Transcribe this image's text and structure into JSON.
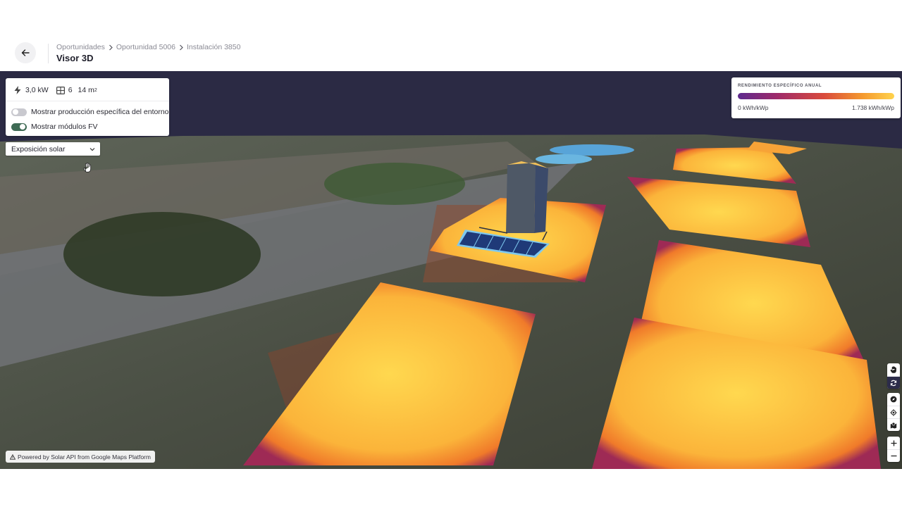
{
  "header": {
    "breadcrumb": [
      "Oportunidades",
      "Oportunidad 5006",
      "Instalación 3850"
    ],
    "title": "Visor 3D",
    "back_icon": "arrow-left-icon"
  },
  "info_panel": {
    "power": "3,0 kW",
    "modules_count": "6",
    "area_value": "14 m",
    "area_unit_sup": "2",
    "toggles": [
      {
        "label": "Mostrar producción específica del entorno",
        "on": false
      },
      {
        "label": "Mostrar módulos FV",
        "on": true
      }
    ]
  },
  "layer_select": {
    "value": "Exposición solar"
  },
  "legend": {
    "title": "RENDIMIENTO ESPECÍFICO ANUAL",
    "min_label": "0 kWh/kWp",
    "max_label": "1.738 kWh/kWp",
    "colors": [
      "#5d2a8e",
      "#9e2a6a",
      "#d94a3c",
      "#f59a2e",
      "#ffd34d"
    ]
  },
  "map_controls": {
    "group1": [
      "hand-pan-icon",
      "rotate-icon"
    ],
    "group2": [
      "compass-icon",
      "locate-icon",
      "map-layers-icon"
    ],
    "group3": [
      "zoom-in-icon",
      "zoom-out-icon"
    ]
  },
  "attribution": {
    "text": "Powered by Solar API from Google Maps Platform"
  },
  "colors": {
    "sky": "#2b2a44",
    "toggle_on": "#3f6b55",
    "panel_blue": "#2f4f8a"
  }
}
